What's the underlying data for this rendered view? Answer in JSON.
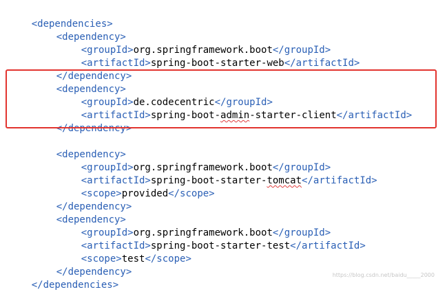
{
  "lines": [
    {
      "indent": 0,
      "open": "<dependencies>"
    },
    {
      "indent": 1,
      "open": "<dependency>"
    },
    {
      "indent": 2,
      "open": "<groupId>",
      "text": "org.springframework.boot",
      "close": "</groupId>"
    },
    {
      "indent": 2,
      "open": "<artifactId>",
      "text": "spring-boot-starter-web",
      "close": "</artifactId>"
    },
    {
      "indent": 1,
      "open": "</dependency>"
    },
    {
      "indent": 1,
      "open": "<dependency>"
    },
    {
      "indent": 2,
      "open": "<groupId>",
      "text": "de.codecentric",
      "close": "</groupId>"
    },
    {
      "indent": 2,
      "open": "<artifactId>",
      "text_pre": "spring-boot-",
      "text_wavy": "admin",
      "text_post": "-starter-client",
      "close": "</artifactId>"
    },
    {
      "indent": 1,
      "open": "</dependency>"
    },
    {
      "indent": 1,
      "open": "<dependency>"
    },
    {
      "indent": 2,
      "open": "<groupId>",
      "text": "org.springframework.boot",
      "close": "</groupId>"
    },
    {
      "indent": 2,
      "open": "<artifactId>",
      "text_pre": "spring-boot-starter-",
      "text_wavy": "tomcat",
      "text_post": "",
      "close": "</artifactId>"
    },
    {
      "indent": 2,
      "open": "<scope>",
      "text": "provided",
      "close": "</scope>"
    },
    {
      "indent": 1,
      "open": "</dependency>"
    },
    {
      "indent": 1,
      "open": "<dependency>"
    },
    {
      "indent": 2,
      "open": "<groupId>",
      "text": "org.springframework.boot",
      "close": "</groupId>"
    },
    {
      "indent": 2,
      "open": "<artifactId>",
      "text": "spring-boot-starter-test",
      "close": "</artifactId>"
    },
    {
      "indent": 2,
      "open": "<scope>",
      "text": "test",
      "close": "</scope>"
    },
    {
      "indent": 1,
      "open": "</dependency>"
    },
    {
      "indent": 0,
      "open": "</dependencies>"
    }
  ],
  "colors": {
    "tag": "#2a5fb5",
    "text": "#000000",
    "highlight_border": "#e2332e",
    "squiggle": "#e03b3b"
  },
  "highlight": {
    "label": "highlighted-dependency-block"
  },
  "watermark": "https://blog.csdn.net/baidu_____2000"
}
